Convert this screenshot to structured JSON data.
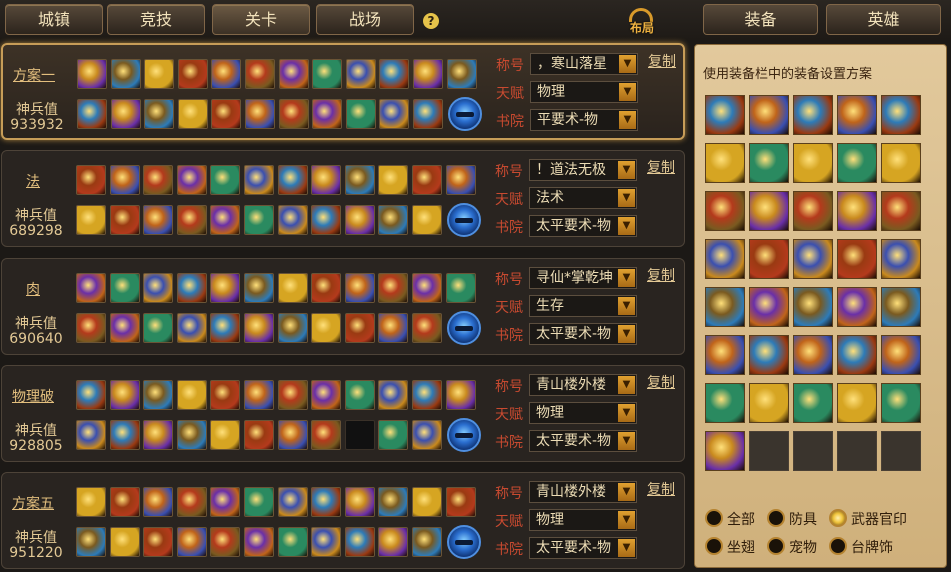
{
  "top_tabs": [
    "城镇",
    "竞技",
    "关卡",
    "战场"
  ],
  "active_tab": "关卡",
  "help_glyph": "?",
  "layout_logo": "布局",
  "right_tabs": [
    "装备",
    "英雄"
  ],
  "row_labels": {
    "title": "称号",
    "talent": "天赋",
    "academy": "书院"
  },
  "power_label": "神兵值",
  "copy_label": "复制",
  "dropdown_arrow": "▼",
  "sets": [
    {
      "name": "方案一",
      "power": "933932",
      "title": "，寒山落星",
      "talent": "物理",
      "academy": "平要术-物",
      "selected": true
    },
    {
      "name": "法",
      "power": "689298",
      "title": "！道法无极",
      "talent": "法术",
      "academy": "太平要术-物",
      "selected": false
    },
    {
      "name": "肉",
      "power": "690640",
      "title": "寻仙*掌乾坤",
      "talent": "生存",
      "academy": "太平要术-物",
      "selected": false
    },
    {
      "name": "物理破",
      "power": "928805",
      "title": "青山楼外楼",
      "talent": "物理",
      "academy": "太平要术-物",
      "selected": false
    },
    {
      "name": "方案五",
      "power": "951220",
      "title": "青山楼外楼",
      "talent": "物理",
      "academy": "太平要术-物",
      "selected": false
    }
  ],
  "panel_title": "使用装备栏中的装备设置方案",
  "filters": [
    {
      "label": "全部",
      "checked": false
    },
    {
      "label": "防具",
      "checked": false
    },
    {
      "label": "武器官印",
      "checked": true
    },
    {
      "label": "坐翅",
      "checked": false
    },
    {
      "label": "宠物",
      "checked": false
    },
    {
      "label": "台牌饰",
      "checked": false
    }
  ],
  "item_colors": [
    "#c98a1e",
    "#9a3a12",
    "#6a2fa8",
    "#2d7bb8",
    "#d6a522",
    "#b43a1c",
    "#3a4fb0",
    "#7a5a20",
    "#c0641a",
    "#2a8a60"
  ]
}
